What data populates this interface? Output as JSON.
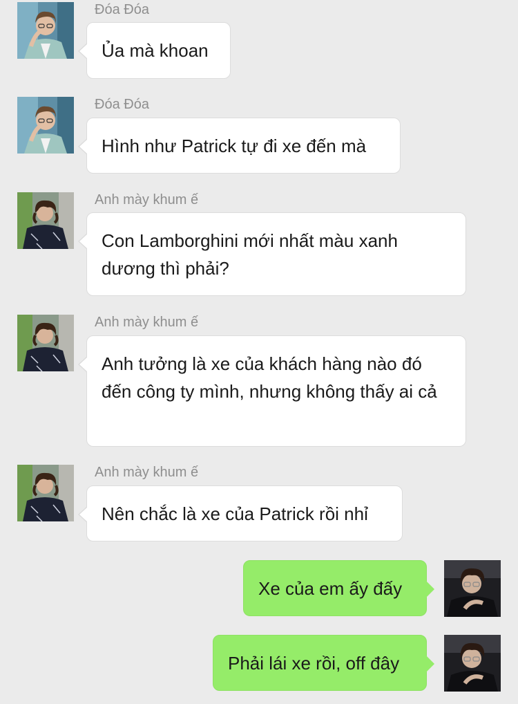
{
  "colors": {
    "background": "#ebebeb",
    "incoming_bubble": "#ffffff",
    "outgoing_bubble": "#95ec69",
    "sender_name": "#8e8e8e"
  },
  "messages": [
    {
      "direction": "incoming",
      "sender": "Đóa Đóa",
      "text": "Ủa mà khoan",
      "avatar": "avatar-doa-doa"
    },
    {
      "direction": "incoming",
      "sender": "Đóa Đóa",
      "text": "Hình như Patrick tự đi xe đến mà",
      "avatar": "avatar-doa-doa"
    },
    {
      "direction": "incoming",
      "sender": "Anh mày khum ế",
      "text": "Con Lamborghini mới nhất màu xanh dương thì phải?",
      "avatar": "avatar-anh-may"
    },
    {
      "direction": "incoming",
      "sender": "Anh mày khum ế",
      "text": "Anh tưởng là xe của khách hàng nào đó đến công ty mình, nhưng không thấy ai cả",
      "avatar": "avatar-anh-may"
    },
    {
      "direction": "incoming",
      "sender": "Anh mày khum ế",
      "text": "Nên chắc là xe của Patrick rồi nhỉ",
      "avatar": "avatar-anh-may"
    },
    {
      "direction": "outgoing",
      "sender": "",
      "text": "Xe của em ấy đấy",
      "avatar": "avatar-self"
    },
    {
      "direction": "outgoing",
      "sender": "",
      "text": "Phải lái xe rồi, off đây",
      "avatar": "avatar-self"
    }
  ]
}
